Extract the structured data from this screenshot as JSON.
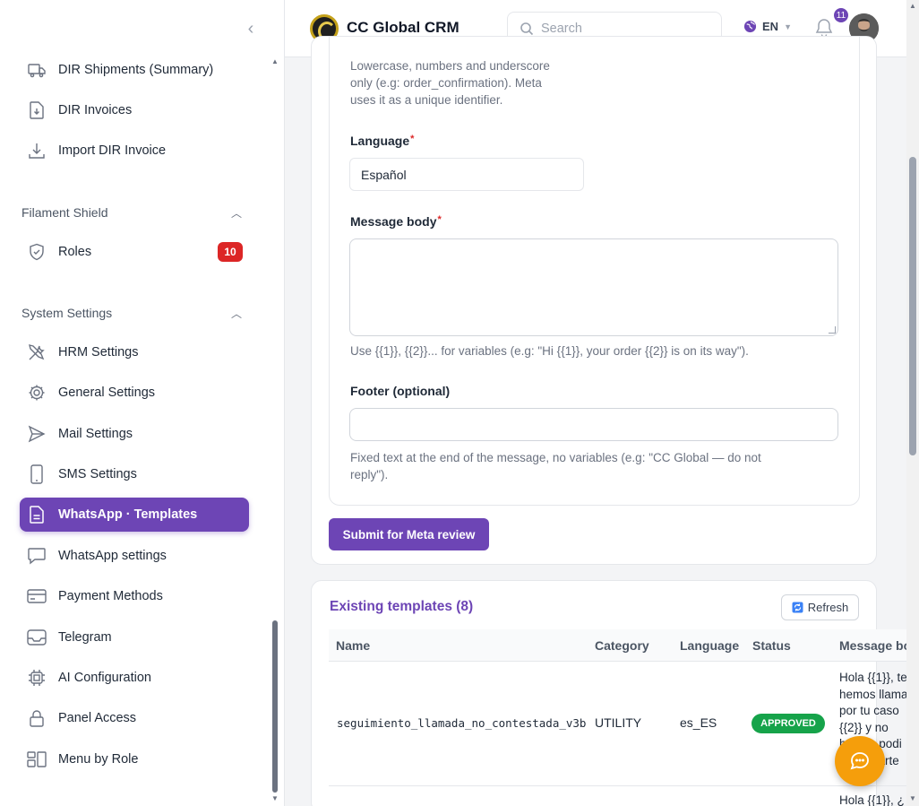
{
  "app": {
    "title": "CC Global CRM"
  },
  "topbar": {
    "search_placeholder": "Search",
    "language": "EN",
    "notifications_count": "11"
  },
  "sidebar": {
    "items_top": [
      {
        "label": "DIR Shipments (Summary)",
        "icon": "truck-icon"
      },
      {
        "label": "DIR Invoices",
        "icon": "document-download-icon"
      },
      {
        "label": "Import DIR Invoice",
        "icon": "download-icon"
      }
    ],
    "groups": [
      {
        "title": "Filament Shield",
        "items": [
          {
            "label": "Roles",
            "icon": "shield-check-icon",
            "badge": "10"
          }
        ]
      },
      {
        "title": "System Settings",
        "items": [
          {
            "label": "HRM Settings",
            "icon": "wrench-screwdriver-icon"
          },
          {
            "label": "General Settings",
            "icon": "cog-icon"
          },
          {
            "label": "Mail Settings",
            "icon": "paper-airplane-icon"
          },
          {
            "label": "SMS Settings",
            "icon": "device-phone-icon"
          },
          {
            "label": "WhatsApp · Templates",
            "icon": "document-text-icon",
            "active": true
          },
          {
            "label": "WhatsApp settings",
            "icon": "chat-bubble-icon"
          },
          {
            "label": "Payment Methods",
            "icon": "credit-card-icon"
          },
          {
            "label": "Telegram",
            "icon": "inbox-icon"
          },
          {
            "label": "AI Configuration",
            "icon": "cpu-chip-icon"
          },
          {
            "label": "Panel Access",
            "icon": "lock-icon"
          },
          {
            "label": "Menu by Role",
            "icon": "squares-icon"
          }
        ]
      }
    ]
  },
  "form": {
    "name_help": [
      "Lowercase, numbers and underscore",
      "only (e.g: order_confirmation). Meta",
      "uses it as a unique identifier."
    ],
    "language_label": "Language",
    "language_value": "Español",
    "message_body_label": "Message body",
    "message_body_help": "Use {{1}}, {{2}}... for variables (e.g: \"Hi {{1}}, your order {{2}} is on its way\").",
    "footer_label": "Footer (optional)",
    "footer_help": [
      "Fixed text at the end of the message, no variables (e.g: \"CC Global — do not",
      "reply\")."
    ],
    "submit_label": "Submit for Meta review",
    "required_mark": "*"
  },
  "templates": {
    "title": "Existing templates (8)",
    "refresh_label": "Refresh",
    "columns": [
      "Name",
      "Category",
      "Language",
      "Status",
      "Message bo"
    ],
    "rows": [
      {
        "name": "seguimiento_llamada_no_contestada_v3b",
        "category": "UTILITY",
        "language": "es_ES",
        "status": "APPROVED",
        "message_lines": [
          "Hola {{1}}, te",
          "hemos llama",
          "por tu caso",
          "{{2}} y no",
          "hemos podi",
          "contactarte"
        ]
      },
      {
        "message_preview": "Hola {{1}}, ¿"
      }
    ]
  },
  "colors": {
    "accent": "#6d45b5",
    "approved": "#16a34a",
    "badge_red": "#dc2626",
    "fab": "#f59e0b"
  }
}
